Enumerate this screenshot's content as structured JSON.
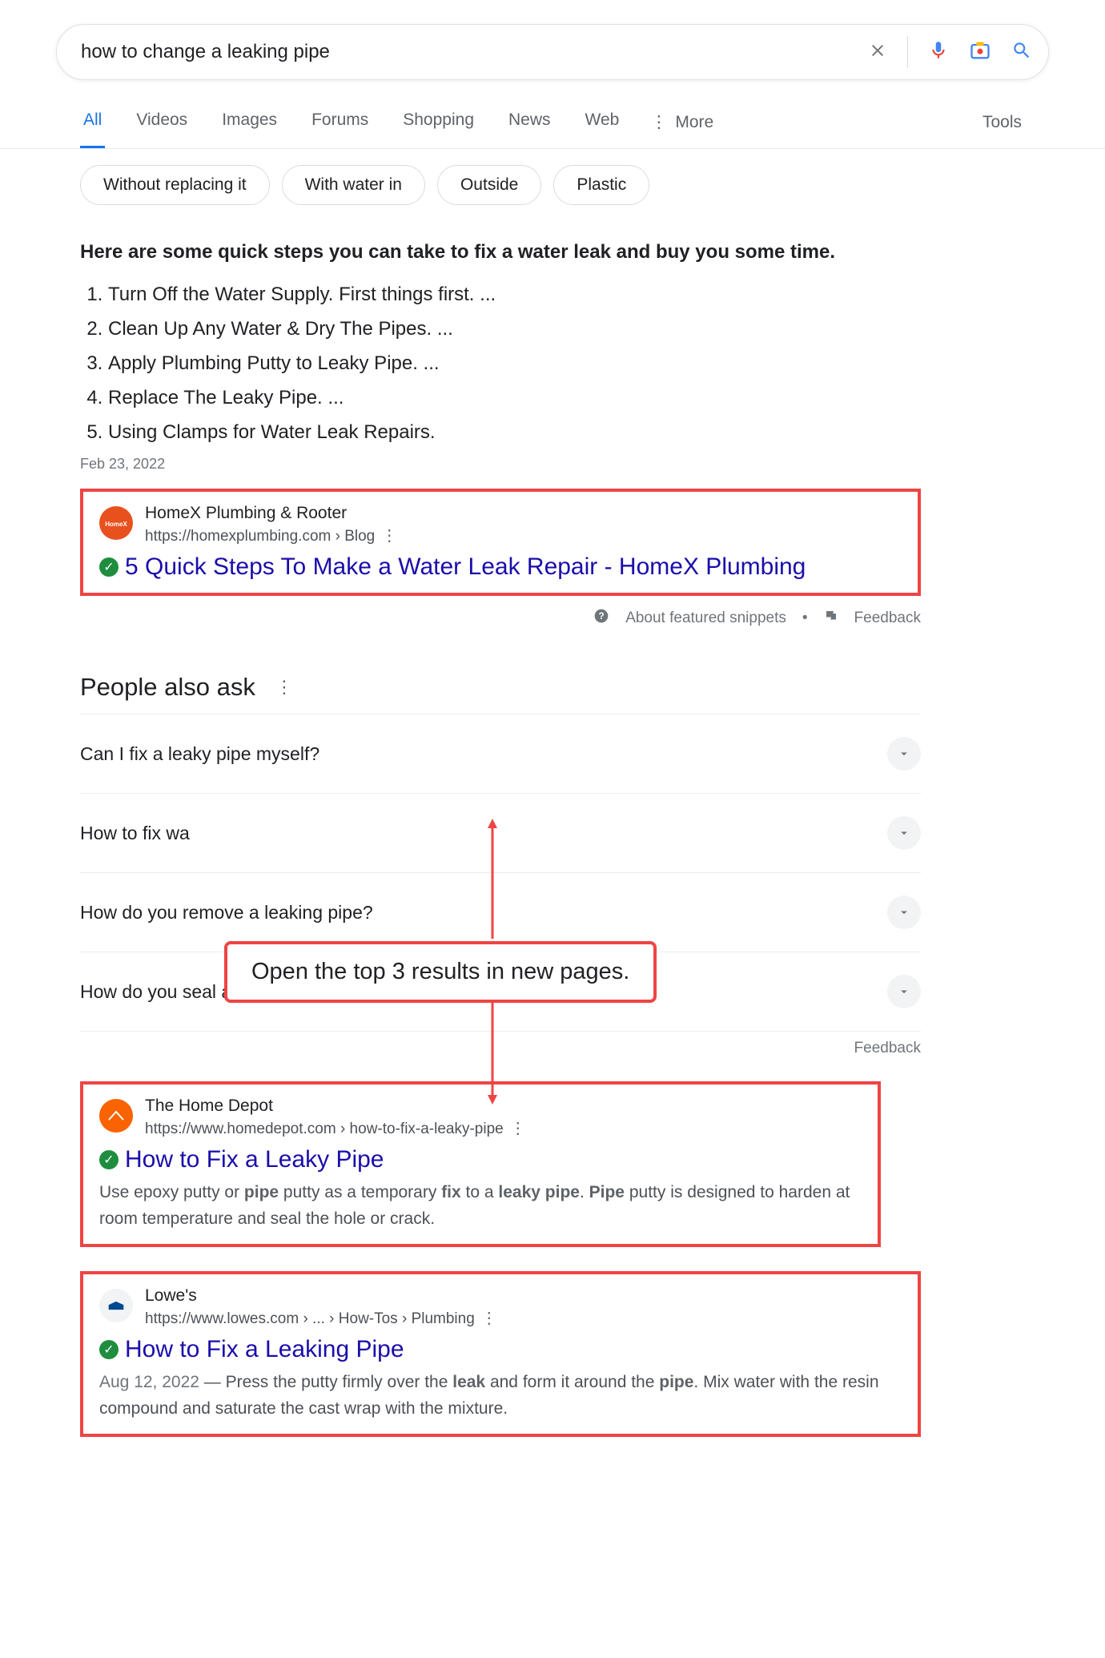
{
  "search": {
    "query": "how to change a leaking pipe"
  },
  "tabs": {
    "all": "All",
    "videos": "Videos",
    "images": "Images",
    "forums": "Forums",
    "shopping": "Shopping",
    "news": "News",
    "web": "Web",
    "more": "More",
    "tools": "Tools"
  },
  "chips": {
    "c0": "Without replacing it",
    "c1": "With water in",
    "c2": "Outside",
    "c3": "Plastic"
  },
  "snippet": {
    "heading": "Here are some quick steps you can take to fix a water leak and buy you some time.",
    "steps": {
      "s1": "Turn Off the Water Supply. First things first. ...",
      "s2": "Clean Up Any Water & Dry The Pipes. ...",
      "s3": "Apply Plumbing Putty to Leaky Pipe. ...",
      "s4": "Replace The Leaky Pipe. ...",
      "s5": "Using Clamps for Water Leak Repairs."
    },
    "date": "Feb 23, 2022",
    "about": "About featured snippets",
    "feedback": "Feedback"
  },
  "result1": {
    "site": "HomeX Plumbing & Rooter",
    "url": "https://homexplumbing.com › Blog",
    "title": "5 Quick Steps To Make a Water Leak Repair - HomeX Plumbing"
  },
  "paa": {
    "header": "People also ask",
    "q1": "Can I fix a leaky pipe myself?",
    "q2": "How to fix wa",
    "q3": "How do you remove a leaking pipe?",
    "q4": "How do you seal a leaking pipe?",
    "feedback": "Feedback"
  },
  "result2": {
    "site": "The Home Depot",
    "url": "https://www.homedepot.com › how-to-fix-a-leaky-pipe",
    "title": "How to Fix a Leaky Pipe",
    "desc_p1": "Use epoxy putty or ",
    "desc_b1": "pipe",
    "desc_p2": " putty as a temporary ",
    "desc_b2": "fix",
    "desc_p3": " to a ",
    "desc_b3": "leaky pipe",
    "desc_p4": ". ",
    "desc_b4": "Pipe",
    "desc_p5": " putty is designed to harden at room temperature and seal the hole or crack."
  },
  "result3": {
    "site": "Lowe's",
    "url": "https://www.lowes.com › ... › How-Tos › Plumbing",
    "title": "How to Fix a Leaking Pipe",
    "desc_date": "Aug 12, 2022",
    "desc_sep": " — ",
    "desc_p1": "Press the putty firmly over the ",
    "desc_b1": "leak",
    "desc_p2": " and form it around the ",
    "desc_b2": "pipe",
    "desc_p3": ". Mix water with the resin compound and saturate the cast wrap with the mixture."
  },
  "annotation": {
    "text": "Open the top 3 results in new pages."
  }
}
